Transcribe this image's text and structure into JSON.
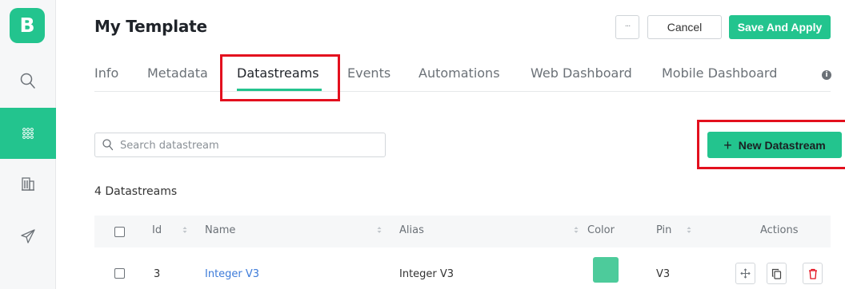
{
  "sidebar": {
    "logo_letter": "B",
    "items": [
      {
        "icon": "search-icon"
      },
      {
        "icon": "templates-grid-icon",
        "active": true
      },
      {
        "icon": "organization-building-icon"
      },
      {
        "icon": "send-paper-plane-icon"
      }
    ]
  },
  "header": {
    "title": "My Template",
    "more_label": "···",
    "cancel_label": "Cancel",
    "save_label": "Save And Apply"
  },
  "tabs": {
    "items": [
      {
        "label": "Info"
      },
      {
        "label": "Metadata"
      },
      {
        "label": "Datastreams",
        "active": true
      },
      {
        "label": "Events"
      },
      {
        "label": "Automations"
      },
      {
        "label": "Web Dashboard"
      },
      {
        "label": "Mobile Dashboard"
      }
    ],
    "info_icon_glyph": "i"
  },
  "search": {
    "placeholder": "Search datastream",
    "value": ""
  },
  "new_datastream_button": {
    "plus": "+",
    "label": "New Datastream"
  },
  "datastream_count": "4 Datastreams",
  "table": {
    "columns": [
      "Id",
      "Name",
      "Alias",
      "Color",
      "Pin",
      "Actions"
    ],
    "rows": [
      {
        "id": "3",
        "name": "Integer V3",
        "alias": "Integer V3",
        "color": "#4dcb9b",
        "pin": "V3"
      }
    ]
  },
  "colors": {
    "accent": "#23c48e",
    "highlight": "#e3101e",
    "link": "#3d7bd9",
    "delete": "#e3101e"
  }
}
